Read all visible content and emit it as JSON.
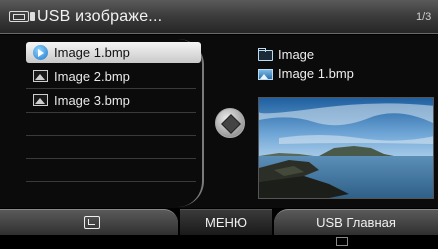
{
  "header": {
    "title": "USB изображе...",
    "page_indicator": "1/3",
    "icon": "usb-drive-icon"
  },
  "file_list": {
    "items": [
      {
        "label": "Image 1.bmp",
        "icon": "play-icon",
        "selected": true
      },
      {
        "label": "Image 2.bmp",
        "icon": "image-file-icon",
        "selected": false
      },
      {
        "label": "Image 3.bmp",
        "icon": "image-file-icon",
        "selected": false
      }
    ]
  },
  "info": {
    "folder_name": "Image",
    "file_name": "Image 1.bmp"
  },
  "bottom_bar": {
    "back_icon": "back-icon",
    "menu_label": "МЕНЮ",
    "home_label": "USB Главная"
  },
  "colors": {
    "selection": "#e6e6e6",
    "accent_blue": "#1e78c8"
  }
}
